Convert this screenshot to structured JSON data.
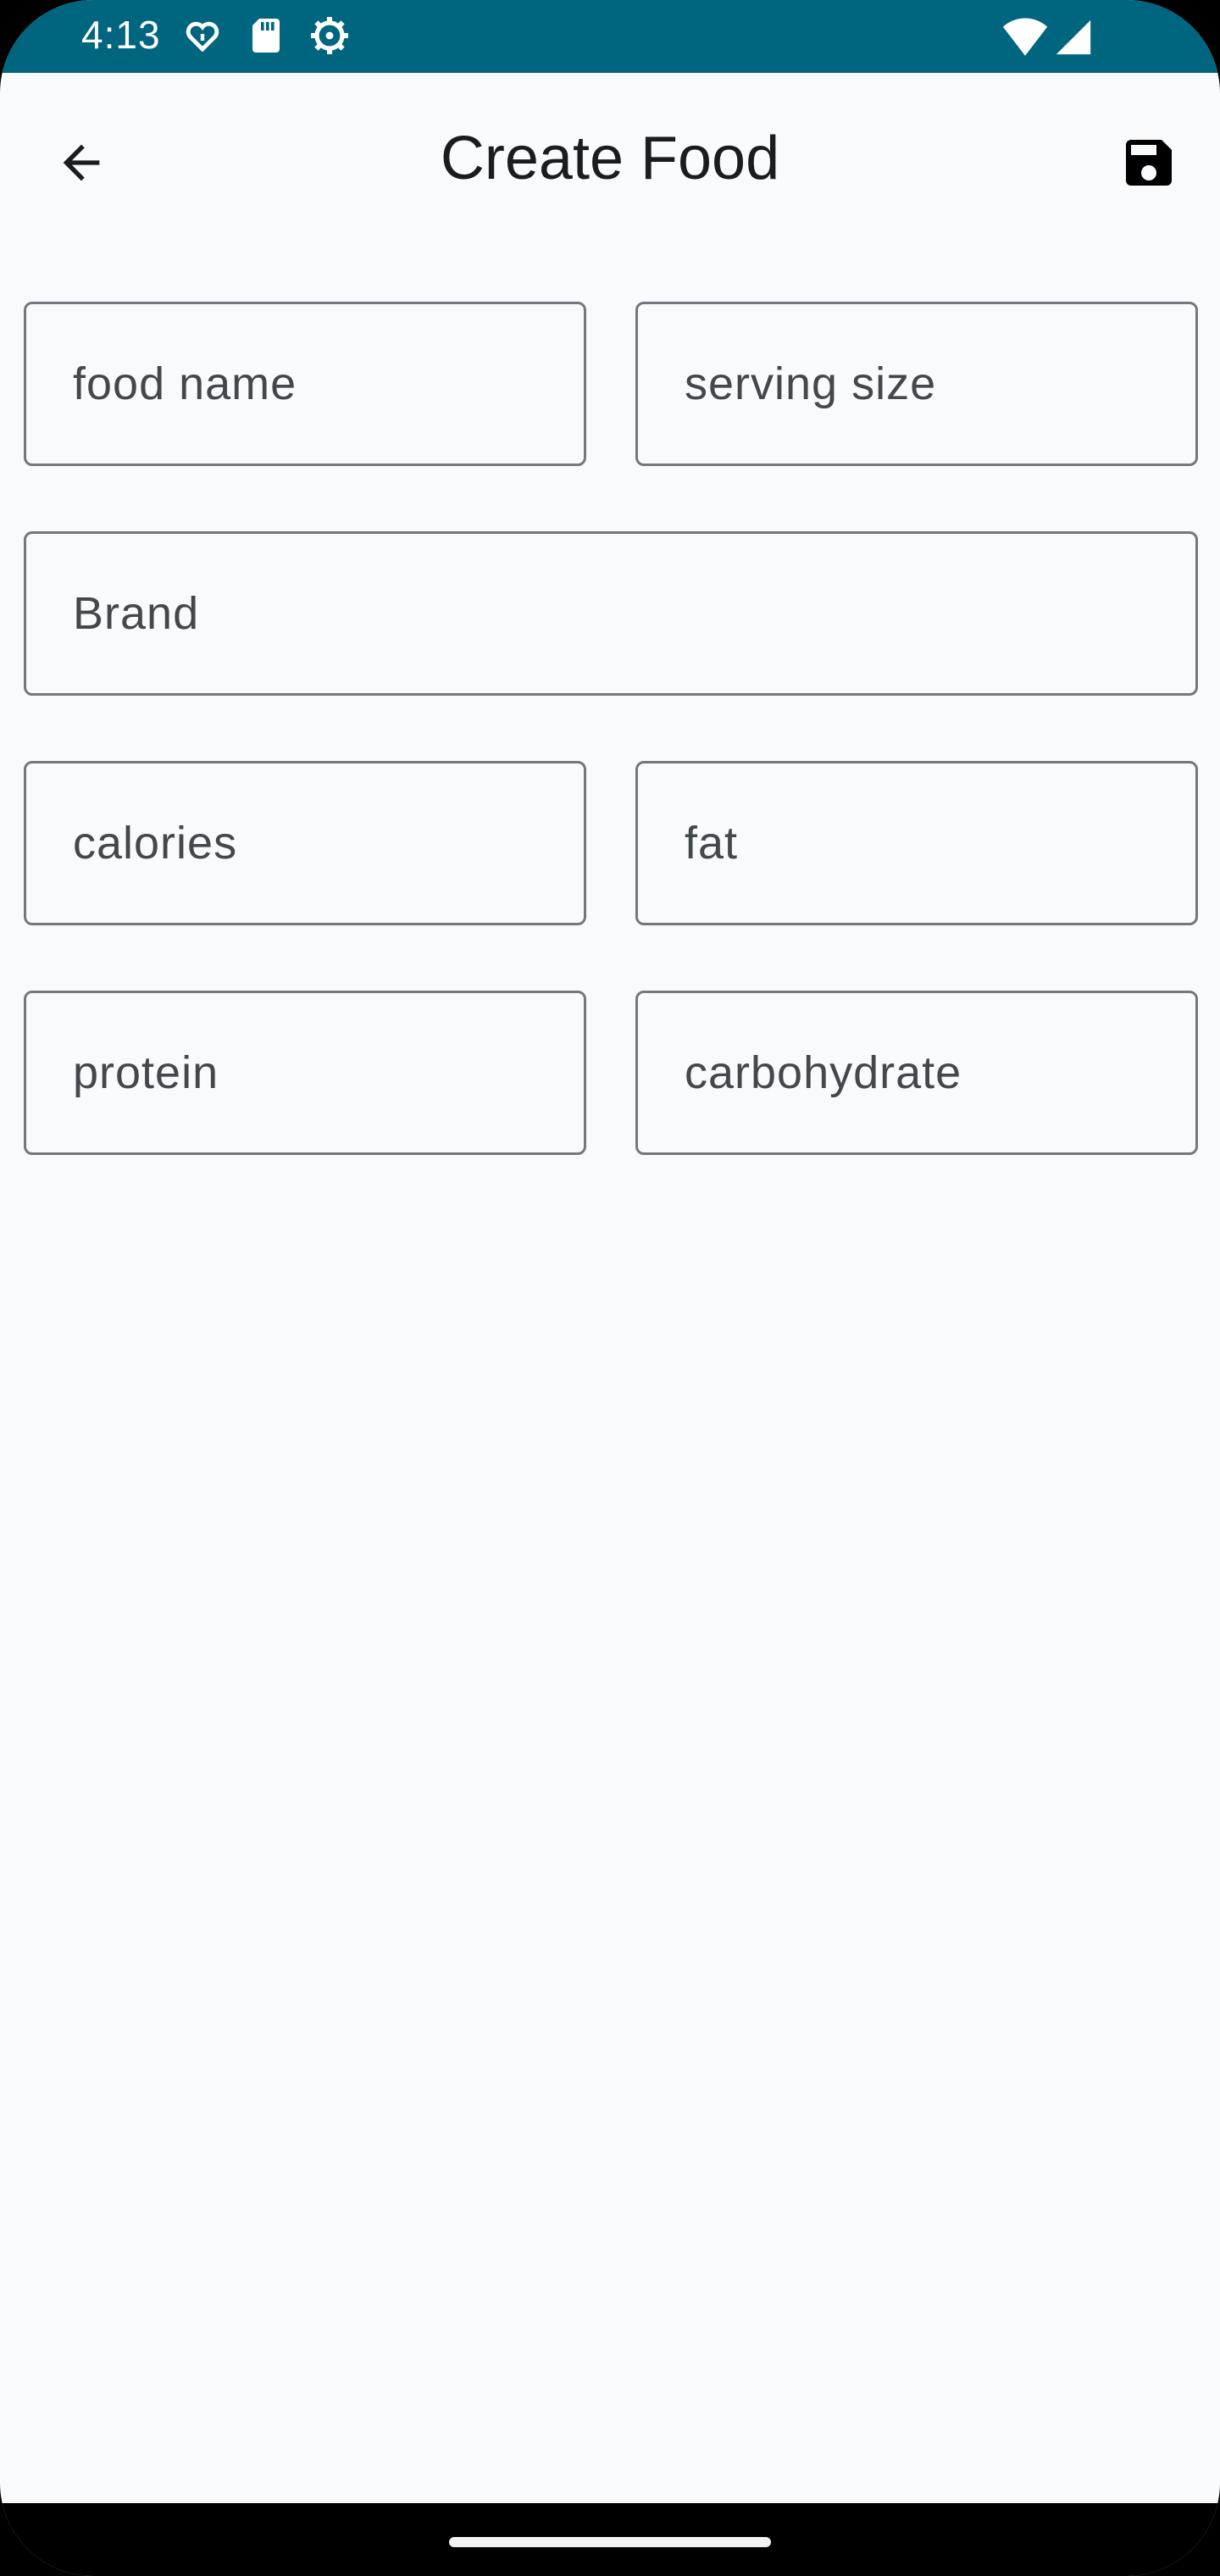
{
  "status_bar": {
    "time": "4:13",
    "left_icons": [
      "heart-pulse-icon",
      "sd-card-icon",
      "settings-gear-icon"
    ],
    "right_icons": [
      "wifi-icon",
      "cell-signal-icon"
    ],
    "color": "#006680"
  },
  "app_bar": {
    "title": "Create Food",
    "back_icon": "arrow-back-icon",
    "save_icon": "floppy-disk-icon"
  },
  "form": {
    "food_name": {
      "placeholder": "food name",
      "value": ""
    },
    "serving_size": {
      "placeholder": "serving size",
      "value": ""
    },
    "brand": {
      "placeholder": "Brand",
      "value": ""
    },
    "calories": {
      "placeholder": "calories",
      "value": ""
    },
    "fat": {
      "placeholder": "fat",
      "value": ""
    },
    "protein": {
      "placeholder": "protein",
      "value": ""
    },
    "carbohydrate": {
      "placeholder": "carbohydrate",
      "value": ""
    }
  },
  "colors": {
    "background": "#f9fafd",
    "field_border": "#74777f",
    "placeholder_text": "#43474e",
    "title_text": "#1b1c1f"
  }
}
